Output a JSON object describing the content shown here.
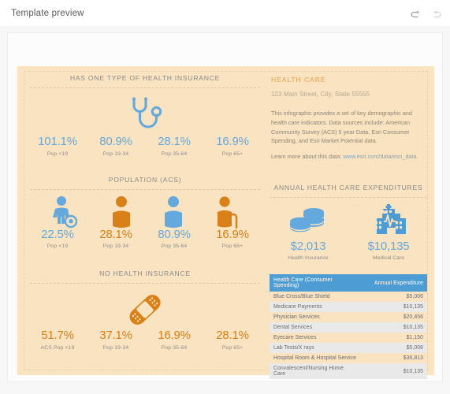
{
  "titlebar": {
    "title": "Template preview",
    "undo_icon": "undo-arrow-icon",
    "redo_icon": "redo-arrow-icon"
  },
  "colors": {
    "blue": "#64a9dd",
    "orange": "#d98018",
    "header_blue": "#4d9dd4",
    "bg_cream": "#fae3c0",
    "title_orange": "#e3a14e"
  },
  "infographic": {
    "insurance_panel": {
      "title": "HAS ONE TYPE OF HEALTH INSURANCE",
      "icon": "stethoscope-icon",
      "stats": [
        {
          "value": "101.1%",
          "label": "Pop <19"
        },
        {
          "value": "80.9%",
          "label": "Pop 19-34"
        },
        {
          "value": "28.1%",
          "label": "Pop 35-64"
        },
        {
          "value": "16.9%",
          "label": "Pop 65+"
        }
      ]
    },
    "population_panel": {
      "title": "POPULATION (ACS)",
      "stats": [
        {
          "value": "22.5%",
          "label": "Pop <19",
          "icon": "child-with-ball-icon",
          "color": "blue"
        },
        {
          "value": "28.1%",
          "label": "Pop 19-34",
          "icon": "adult-person-icon",
          "color": "orange"
        },
        {
          "value": "80.9%",
          "label": "Pop 35-64",
          "icon": "adult-person-icon",
          "color": "blue"
        },
        {
          "value": "16.9%",
          "label": "Pop 65+",
          "icon": "elderly-with-cane-icon",
          "color": "orange"
        }
      ]
    },
    "no_insurance_panel": {
      "title": "NO HEALTH INSURANCE",
      "icon": "bandage-icon",
      "stats": [
        {
          "value": "51.7%",
          "label": "ACS Pop <19"
        },
        {
          "value": "37.1%",
          "label": "Pop 19-34"
        },
        {
          "value": "16.9%",
          "label": "Pop 35-64"
        },
        {
          "value": "28.1%",
          "label": "Pop 65+"
        }
      ]
    },
    "header": {
      "title": "HEALTH CARE",
      "address": "123 Main Street, City, State 55555",
      "body": "This infographic provides a set of key demographic and health care indicators. Data sources include: American Community Survey (ACS) 5 year Data, Esri Consumer Spending, and Esri Market Potential data.",
      "learn_prefix": "Learn more about this data: ",
      "learn_link": "www.esri.com/data/esri_data."
    },
    "expenditures_panel": {
      "title": "ANNUAL HEALTH CARE EXPENDITURES",
      "items": [
        {
          "value": "$2,013",
          "label": "Health Insurance",
          "icon": "stacked-coins-icon"
        },
        {
          "value": "$10,135",
          "label": "Medical Care",
          "icon": "hospital-building-icon"
        }
      ]
    },
    "spending_table": {
      "columns": [
        "Health Care (Consumer Spending)",
        "Annual Expenditure"
      ],
      "rows": [
        {
          "name": "Blue Cross/Blue Shield",
          "amount": "$5,006"
        },
        {
          "name": "Medicare Payments",
          "amount": "$10,135"
        },
        {
          "name": "Physician Services",
          "amount": "$20,456"
        },
        {
          "name": "Dental Services",
          "amount": "$10,135"
        },
        {
          "name": "Eyecare Services",
          "amount": "$1,150"
        },
        {
          "name": "Lab Tests/X rays",
          "amount": "$5,006"
        },
        {
          "name": "Hospital Room & Hospital Service",
          "amount": "$36,813"
        },
        {
          "name": "Convalescent/Nursing Home Care",
          "amount": "$10,135"
        }
      ]
    }
  }
}
